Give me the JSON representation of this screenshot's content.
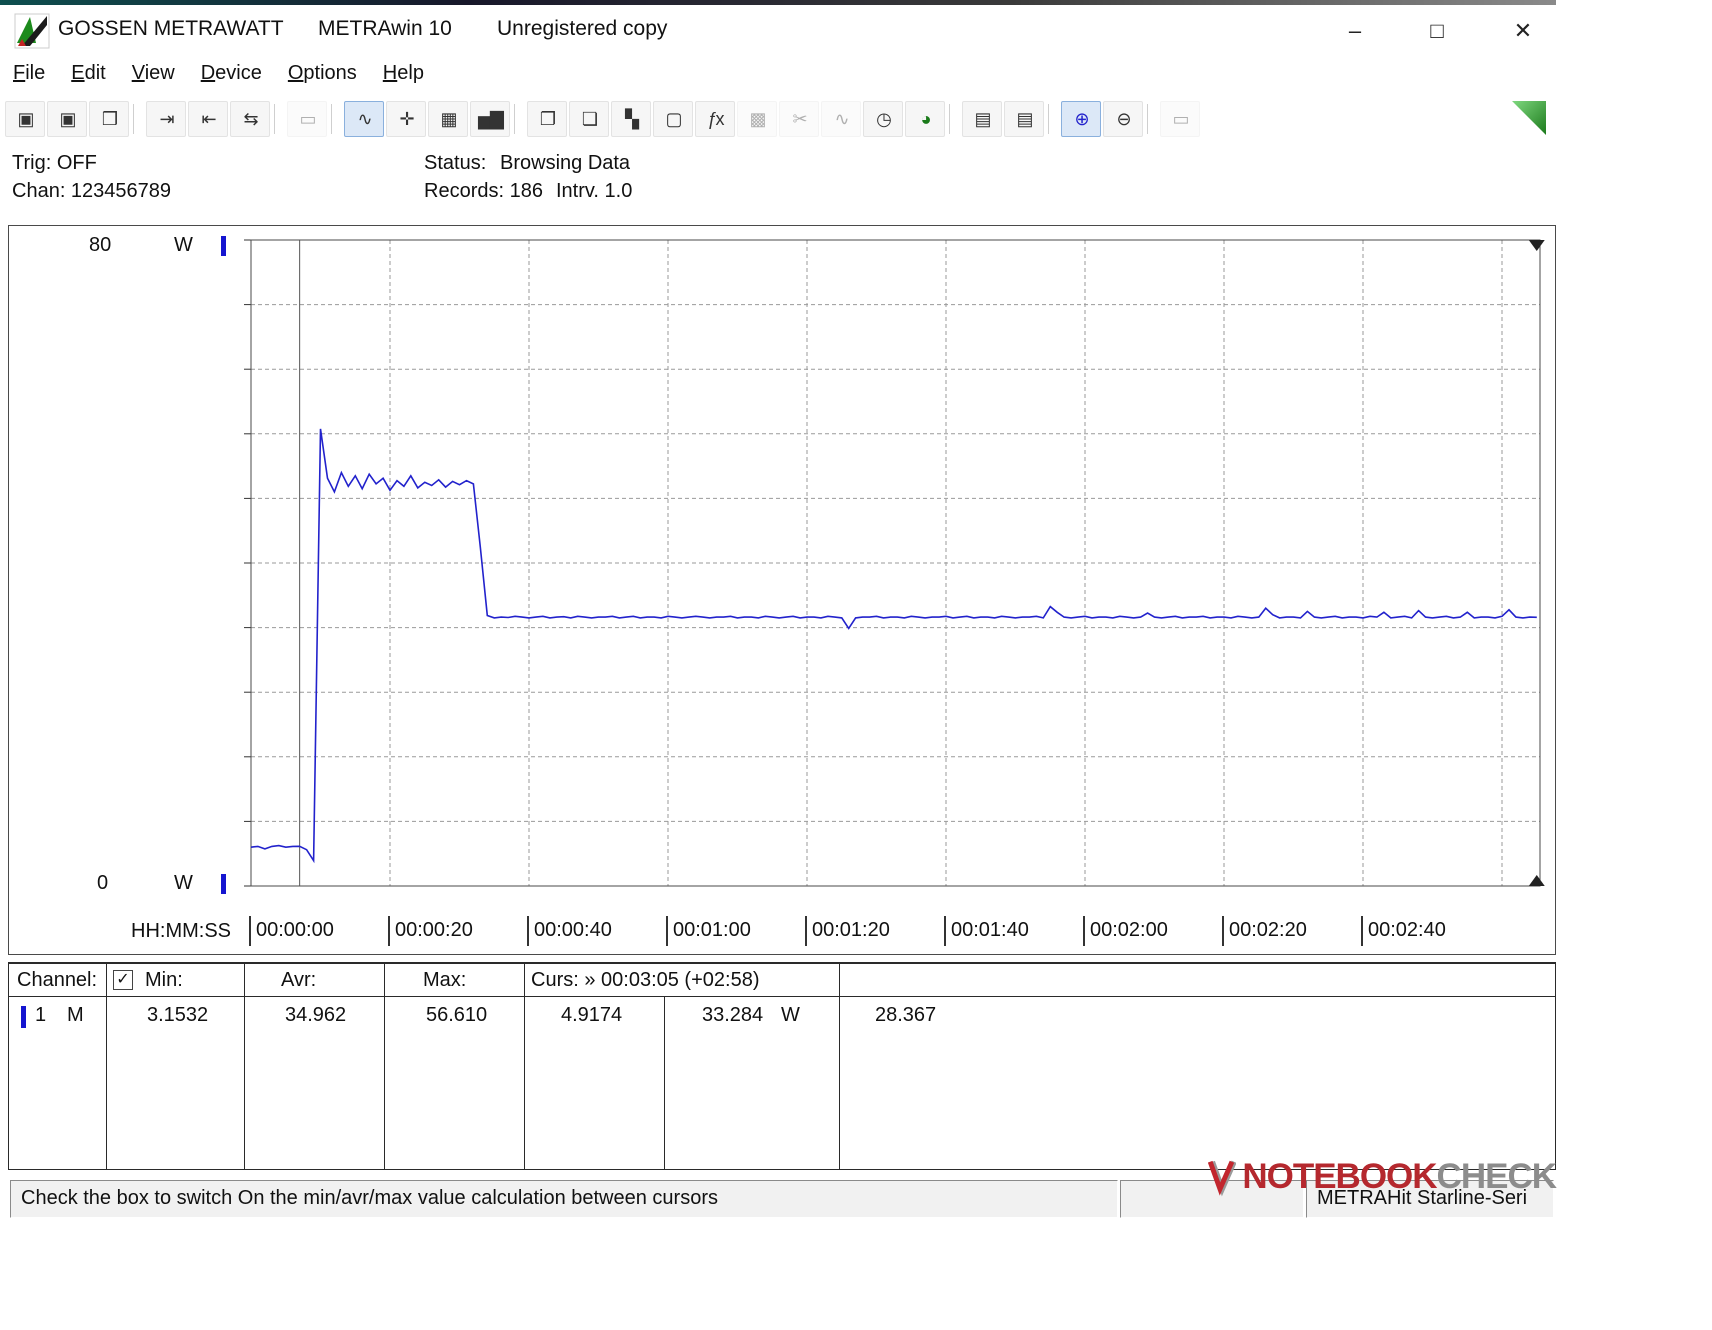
{
  "window": {
    "brand": "GOSSEN METRAWATT",
    "app": "METRAwin 10",
    "license": "Unregistered copy",
    "controls": {
      "minimize": "–",
      "maximize": "□",
      "close": "✕"
    }
  },
  "menu": [
    "File",
    "Edit",
    "View",
    "Device",
    "Options",
    "Help"
  ],
  "toolbar": [
    {
      "name": "save",
      "glyph": "▣",
      "state": "normal"
    },
    {
      "name": "save-as",
      "glyph": "▣",
      "state": "normal"
    },
    {
      "name": "open",
      "glyph": "❒",
      "state": "normal"
    },
    {
      "sep": true
    },
    {
      "name": "read-device",
      "glyph": "⇥",
      "state": "normal"
    },
    {
      "name": "read-30k",
      "glyph": "⇤",
      "state": "normal"
    },
    {
      "name": "read-memory",
      "glyph": "⇆",
      "state": "normal"
    },
    {
      "sep": true
    },
    {
      "name": "numeric-display",
      "glyph": "▭",
      "state": "disabled"
    },
    {
      "sep": true
    },
    {
      "name": "trend-view",
      "glyph": "∿",
      "state": "active"
    },
    {
      "name": "scope-view",
      "glyph": "✛",
      "state": "normal"
    },
    {
      "name": "table-view",
      "glyph": "▦",
      "state": "normal"
    },
    {
      "name": "bar-view",
      "glyph": "▅▇",
      "state": "normal"
    },
    {
      "sep": true
    },
    {
      "name": "export-window",
      "glyph": "❐",
      "state": "normal"
    },
    {
      "name": "import-window",
      "glyph": "❏",
      "state": "normal"
    },
    {
      "name": "tile-windows",
      "glyph": "▚",
      "state": "normal"
    },
    {
      "name": "monitor",
      "glyph": "▢",
      "state": "normal"
    },
    {
      "name": "function",
      "glyph": "ƒx",
      "state": "normal"
    },
    {
      "name": "calculator",
      "glyph": "▩",
      "state": "disabled"
    },
    {
      "name": "wave-cut",
      "glyph": "✂",
      "state": "disabled"
    },
    {
      "name": "waveform",
      "glyph": "∿",
      "state": "disabled"
    },
    {
      "name": "timer",
      "glyph": "◷",
      "state": "normal"
    },
    {
      "name": "meter",
      "glyph": "◕",
      "state": "normal",
      "color": "#1a7a1a"
    },
    {
      "sep": true
    },
    {
      "name": "print",
      "glyph": "▤",
      "state": "normal"
    },
    {
      "name": "print-preview",
      "glyph": "▤",
      "state": "normal"
    },
    {
      "sep": true
    },
    {
      "name": "zoom-wave",
      "glyph": "⊕",
      "state": "active",
      "color": "#2222cc"
    },
    {
      "name": "zoom",
      "glyph": "⊖",
      "state": "normal"
    },
    {
      "sep": true
    },
    {
      "name": "annotate",
      "glyph": "▭",
      "state": "disabled"
    }
  ],
  "info": {
    "trig": "Trig: OFF",
    "chan": "Chan: 123456789",
    "status_label": "Status:",
    "status_value": "Browsing Data",
    "records": "Records: 186",
    "interval": "Intrv. 1.0"
  },
  "chart": {
    "y_top": "80",
    "y_top_unit": "W",
    "y_bottom": "0",
    "y_bottom_unit": "W",
    "x_title": "HH:MM:SS"
  },
  "chart_data": {
    "type": "line",
    "title": "Power draw over time (METRAwin trend view)",
    "xlabel": "HH:MM:SS",
    "ylabel": "W",
    "ylim": [
      0,
      80
    ],
    "records": 186,
    "interval_s": 1.0,
    "x_tick_interval_s": 20,
    "x_ticks": [
      "00:00:00",
      "00:00:20",
      "00:00:40",
      "00:01:00",
      "00:01:20",
      "00:01:40",
      "00:02:00",
      "00:02:20",
      "00:02:40"
    ],
    "grid": true,
    "legend": false,
    "line_color": "#2222cc",
    "cursors": {
      "cursor1_time": "00:00:07",
      "cursor1_value": 4.9174,
      "cursor2_time": "00:03:05",
      "cursor2_value": 33.284,
      "delta_time": "+02:58",
      "delta_value": 28.367
    },
    "stats": {
      "min": 3.1532,
      "avg": 34.962,
      "max": 56.61
    },
    "series": [
      {
        "name": "Channel 1 (M)",
        "values": [
          4.8,
          4.9,
          4.6,
          4.9,
          5.0,
          4.8,
          4.9,
          4.92,
          4.5,
          3.15,
          56.61,
          50.5,
          48.8,
          51.2,
          49.5,
          50.8,
          49.2,
          51.0,
          49.8,
          50.5,
          49.0,
          50.2,
          49.5,
          50.8,
          49.3,
          50.0,
          49.6,
          50.3,
          49.4,
          50.1,
          49.7,
          50.2,
          49.8,
          42.0,
          33.5,
          33.2,
          33.3,
          33.25,
          33.4,
          33.3,
          33.2,
          33.3,
          33.4,
          33.2,
          33.3,
          33.35,
          33.2,
          33.4,
          33.3,
          33.2,
          33.3,
          33.3,
          33.4,
          33.2,
          33.3,
          33.4,
          33.2,
          33.3,
          33.3,
          33.2,
          33.4,
          33.3,
          33.2,
          33.3,
          33.4,
          33.3,
          33.2,
          33.3,
          33.3,
          33.4,
          33.2,
          33.3,
          33.3,
          33.2,
          33.4,
          33.3,
          33.2,
          33.3,
          33.4,
          33.2,
          33.3,
          33.3,
          33.2,
          33.4,
          33.3,
          33.2,
          31.9,
          33.2,
          33.3,
          33.3,
          33.4,
          33.2,
          33.3,
          33.3,
          33.2,
          33.4,
          33.3,
          33.2,
          33.3,
          33.3,
          33.4,
          33.2,
          33.3,
          33.4,
          33.2,
          33.3,
          33.3,
          33.2,
          33.4,
          33.3,
          33.2,
          33.3,
          33.3,
          33.4,
          33.2,
          34.6,
          33.9,
          33.3,
          33.2,
          33.3,
          33.4,
          33.2,
          33.3,
          33.3,
          33.2,
          33.4,
          33.3,
          33.2,
          33.3,
          33.8,
          33.3,
          33.2,
          33.3,
          33.4,
          33.2,
          33.3,
          33.3,
          33.4,
          33.2,
          33.3,
          33.3,
          33.2,
          33.4,
          33.3,
          33.2,
          33.3,
          34.4,
          33.6,
          33.2,
          33.3,
          33.3,
          33.2,
          34.0,
          33.3,
          33.2,
          33.3,
          33.4,
          33.2,
          33.3,
          33.3,
          33.2,
          33.4,
          33.3,
          33.9,
          33.2,
          33.3,
          33.4,
          33.2,
          34.1,
          33.3,
          33.2,
          33.3,
          33.4,
          33.2,
          33.3,
          33.9,
          33.2,
          33.3,
          33.3,
          33.2,
          33.4,
          34.2,
          33.3,
          33.2,
          33.3,
          33.28
        ]
      }
    ]
  },
  "table": {
    "header": {
      "channel": "Channel:",
      "min": "Min:",
      "avr": "Avr:",
      "max": "Max:",
      "curs": "Curs: » 00:03:05 (+02:58)"
    },
    "checkbox_checked": "✓",
    "row": {
      "channel": "1",
      "mode": "M",
      "min": "3.1532",
      "avr": "34.962",
      "max": "56.610",
      "curs_a": "4.9174",
      "curs_b": "33.284",
      "unit": "W",
      "delta": "28.367"
    }
  },
  "statusbar": {
    "hint": "Check the box to switch On the min/avr/max value calculation between cursors",
    "panel2": "",
    "device": "METRAHit Starline-Seri"
  },
  "watermark": {
    "part1": "NOTEBOOK",
    "part2": "CHECK"
  }
}
